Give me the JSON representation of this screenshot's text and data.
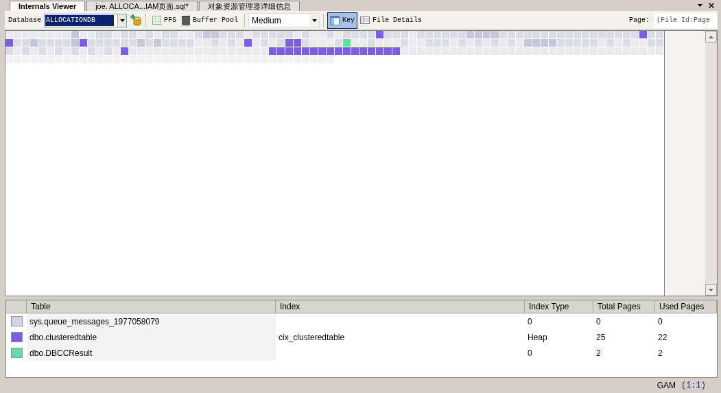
{
  "tabs": [
    {
      "label": "Internals Viewer",
      "selected": true
    },
    {
      "label": "joe. ALLOCA...IAM页面.sql*",
      "selected": false
    },
    {
      "label": "对象资源管理器详细信息",
      "selected": false
    }
  ],
  "toolbar": {
    "database_label": "Database",
    "database": {
      "value": "ALLOCATIONDB",
      "text_selected": true
    },
    "toggles": [
      {
        "kind": "pfs",
        "label": "PFS",
        "selected": false
      },
      {
        "kind": "buffer",
        "label": "Buffer Pool",
        "selected": false
      }
    ],
    "size": {
      "value": "Medium"
    },
    "view_toggles": [
      {
        "kind": "key",
        "label": "Key",
        "selected": true
      },
      {
        "kind": "details",
        "label": "File Details",
        "selected": false
      }
    ],
    "page_label": "Page:",
    "page_field": {
      "placeholder": "(File Id:Page"
    }
  },
  "page_map": {
    "rows": [
      [
        {
          "color": "#ebebef"
        },
        {
          "color": "#ebebef"
        },
        {
          "color": "#ebebef"
        },
        {
          "color": "#ebebef"
        },
        {
          "color": "#ebebef"
        },
        {
          "color": "#ebebef"
        },
        {
          "color": "#ebebef"
        },
        {
          "color": "#ebebef"
        },
        {
          "color": "#c6c6da"
        },
        {
          "color": "#ebebef"
        },
        {
          "color": "#ebebef"
        },
        {
          "color": "#dcdce9"
        },
        {
          "color": "#dcdce9"
        },
        {
          "color": "#ebebef"
        },
        {
          "color": "#dcdce9"
        },
        {
          "color": "#dcdce9"
        },
        {
          "color": "#ebebef"
        },
        {
          "color": "#dcdce9"
        },
        {
          "color": "#ebebef"
        },
        {
          "color": "#dcdce9"
        },
        {
          "color": "#dcdce9"
        },
        {
          "color": "#ebebef"
        },
        {
          "color": "#ebebef"
        },
        {
          "color": "#dcdce9"
        },
        {
          "color": "#c6c6da"
        },
        {
          "color": "#c6c6da"
        },
        {
          "color": "#dcdce9"
        },
        {
          "color": "#dcdce9"
        },
        {
          "color": "#dcdce9"
        },
        {
          "color": "#ebebef"
        },
        {
          "color": "#dcdce9"
        },
        {
          "color": "#dcdce9"
        },
        {
          "color": "#dcdce9"
        },
        {
          "color": "#dcdce9"
        },
        {
          "color": "#dcdce9"
        },
        {
          "color": "#ebebef"
        },
        {
          "color": "#dcdce9"
        },
        {
          "color": "#ebebef"
        },
        {
          "color": "#ebebef"
        },
        {
          "color": "#dcdce9"
        },
        {
          "color": "#ebebef"
        },
        {
          "color": "#dcdce9"
        },
        {
          "color": "#dcdce9"
        },
        {
          "color": "#dcdce9"
        },
        {
          "color": "#dcdce9"
        },
        {
          "color": "#7b5fe0"
        },
        {
          "color": "#dcdce9"
        },
        {
          "color": "#dcdce9"
        },
        {
          "color": "#dcdce9"
        },
        {
          "color": "#ebebef"
        },
        {
          "color": "#dcdce9"
        },
        {
          "color": "#dcdce9"
        },
        {
          "color": "#dcdce9"
        },
        {
          "color": "#dcdce9"
        },
        {
          "color": "#dcdce9"
        },
        {
          "color": "#dcdce9"
        },
        {
          "color": "#c6c6da"
        },
        {
          "color": "#c6c6da"
        },
        {
          "color": "#c6c6da"
        },
        {
          "color": "#c6c6da"
        },
        {
          "color": "#dcdce9"
        },
        {
          "color": "#dcdce9"
        },
        {
          "color": "#dcdce9"
        },
        {
          "color": "#dcdce9"
        },
        {
          "color": "#dcdce9"
        },
        {
          "color": "#dcdce9"
        },
        {
          "color": "#dcdce9"
        },
        {
          "color": "#dcdce9"
        },
        {
          "color": "#dcdce9"
        },
        {
          "color": "#dcdce9"
        },
        {
          "color": "#dcdce9"
        },
        {
          "color": "#dcdce9"
        },
        {
          "color": "#dcdce9"
        },
        {
          "color": "#dcdce9"
        },
        {
          "color": "#dcdce9"
        },
        {
          "color": "#dcdce9"
        },
        {
          "color": "#dcdce9"
        },
        {
          "color": "#7b5fe0"
        },
        {
          "color": "#dcdce9"
        },
        {
          "color": "#dcdce9"
        }
      ],
      [
        {
          "color": "#7b5fe0"
        },
        {
          "color": "#dcdce9"
        },
        {
          "color": "#dcdce9"
        },
        {
          "color": "#c6c6da"
        },
        {
          "color": "#dcdce9"
        },
        {
          "color": "#dcdce9"
        },
        {
          "color": "#dcdce9"
        },
        {
          "color": "#dcdce9"
        },
        {
          "color": "#c6c6da"
        },
        {
          "color": "#7b5fe0"
        },
        {
          "color": "#dcdce9"
        },
        {
          "color": "#dcdce9"
        },
        {
          "color": "#dcdce9"
        },
        {
          "color": "#dcdce9"
        },
        {
          "color": "#dcdce9"
        },
        {
          "color": "#dcdce9"
        },
        {
          "color": "#c6c6da"
        },
        {
          "color": "#dcdce9"
        },
        {
          "color": "#c6c6da"
        },
        {
          "color": "#dcdce9"
        },
        {
          "color": "#dcdce9"
        },
        {
          "color": "#dcdce9"
        },
        {
          "color": "#dcdce9"
        },
        {
          "color": "#ebebef"
        },
        {
          "color": "#ebebef"
        },
        {
          "color": "#dcdce9"
        },
        {
          "color": "#ebebef"
        },
        {
          "color": "#dcdce9"
        },
        {
          "color": "#ebebef"
        },
        {
          "color": "#7b5fe0"
        },
        {
          "color": "#ebebef"
        },
        {
          "color": "#dcdce9"
        },
        {
          "color": "#ebebef"
        },
        {
          "color": "#dcdce9"
        },
        {
          "color": "#7b5fe0"
        },
        {
          "color": "#7b5fe0"
        },
        {
          "color": "#dcdce9"
        },
        {
          "color": "#ebebef"
        },
        {
          "color": "#ebebef"
        },
        {
          "color": "#ebebef"
        },
        {
          "color": "#dcdce9"
        },
        {
          "color": "#5fe0a0"
        },
        {
          "color": "#ebebef"
        },
        {
          "color": "#ebebef"
        },
        {
          "color": "#dcdce9"
        },
        {
          "color": "#ebebef"
        },
        {
          "color": "#ebebef"
        },
        {
          "color": "#ebebef"
        },
        {
          "color": "#dcdce9"
        },
        {
          "color": "#ebebef"
        },
        {
          "color": "#ebebef"
        },
        {
          "color": "#dcdce9"
        },
        {
          "color": "#dcdce9"
        },
        {
          "color": "#dcdce9"
        },
        {
          "color": "#ebebef"
        },
        {
          "color": "#dcdce9"
        },
        {
          "color": "#ebebef"
        },
        {
          "color": "#dcdce9"
        },
        {
          "color": "#ebebef"
        },
        {
          "color": "#dcdce9"
        },
        {
          "color": "#ebebef"
        },
        {
          "color": "#dcdce9"
        },
        {
          "color": "#ebebef"
        },
        {
          "color": "#c6c6da"
        },
        {
          "color": "#c6c6da"
        },
        {
          "color": "#c6c6da"
        },
        {
          "color": "#c6c6da"
        },
        {
          "color": "#dcdce9"
        },
        {
          "color": "#dcdce9"
        },
        {
          "color": "#dcdce9"
        },
        {
          "color": "#dcdce9"
        },
        {
          "color": "#dcdce9"
        },
        {
          "color": "#ebebef"
        },
        {
          "color": "#dcdce9"
        },
        {
          "color": "#ebebef"
        },
        {
          "color": "#dcdce9"
        },
        {
          "color": "#ebebef"
        },
        {
          "color": "#ebebef"
        },
        {
          "color": "#dcdce9"
        },
        {
          "color": "#dcdce9"
        }
      ],
      [
        {
          "color": "#dcdce9"
        },
        {
          "color": "#ebebef"
        },
        {
          "color": "#dcdce9"
        },
        {
          "color": "#ebebef"
        },
        {
          "color": "#dcdce9"
        },
        {
          "color": "#ebebef"
        },
        {
          "color": "#dcdce9"
        },
        {
          "color": "#ebebef"
        },
        {
          "color": "#dcdce9"
        },
        {
          "color": "#ebebef"
        },
        {
          "color": "#dcdce9"
        },
        {
          "color": "#ebebef"
        },
        {
          "color": "#dcdce9"
        },
        {
          "color": "#ebebef"
        },
        {
          "color": "#7b5fe0"
        },
        {
          "color": "#ebebef"
        },
        {
          "color": "#ebebef"
        },
        {
          "color": "#ebebef"
        },
        {
          "color": "#ebebef"
        },
        {
          "color": "#ebebef"
        },
        {
          "color": "#ebebef"
        },
        {
          "color": "#ebebef"
        },
        {
          "color": "#ebebef"
        },
        {
          "color": "#ebebef"
        },
        {
          "color": "#ebebef"
        },
        {
          "color": "#ebebef"
        },
        {
          "color": "#ebebef"
        },
        {
          "color": "#ebebef"
        },
        {
          "color": "#ebebef"
        },
        {
          "color": "#ebebef"
        },
        {
          "color": "#ebebef"
        },
        {
          "color": "#ebebef"
        },
        {
          "color": "#7b5fe0"
        },
        {
          "color": "#7b5fe0"
        },
        {
          "color": "#7b5fe0"
        },
        {
          "color": "#7b5fe0"
        },
        {
          "color": "#7b5fe0"
        },
        {
          "color": "#7b5fe0"
        },
        {
          "color": "#7b5fe0"
        },
        {
          "color": "#7b5fe0"
        },
        {
          "color": "#7b5fe0"
        },
        {
          "color": "#7b5fe0"
        },
        {
          "color": "#7b5fe0"
        },
        {
          "color": "#7b5fe0"
        },
        {
          "color": "#7b5fe0"
        },
        {
          "color": "#7b5fe0"
        },
        {
          "color": "#7b5fe0"
        },
        {
          "color": "#7b5fe0"
        },
        {
          "color": "#ebebef"
        },
        {
          "color": "#ebebef"
        },
        {
          "color": "#ebebef"
        },
        {
          "color": "#ebebef"
        },
        {
          "color": "#ebebef"
        },
        {
          "color": "#ebebef"
        },
        {
          "color": "#ebebef"
        },
        {
          "color": "#ebebef"
        },
        {
          "color": "#ebebef"
        },
        {
          "color": "#ebebef"
        },
        {
          "color": "#ebebef"
        },
        {
          "color": "#ebebef"
        },
        {
          "color": "#ebebef"
        },
        {
          "color": "#ebebef"
        },
        {
          "color": "#ebebef"
        },
        {
          "color": "#ebebef"
        },
        {
          "color": "#ebebef"
        },
        {
          "color": "#ebebef"
        },
        {
          "color": "#ebebef"
        },
        {
          "color": "#ebebef"
        },
        {
          "color": "#ebebef"
        },
        {
          "color": "#ebebef"
        },
        {
          "color": "#ebebef"
        },
        {
          "color": "#ebebef"
        },
        {
          "color": "#ebebef"
        },
        {
          "color": "#ebebef"
        },
        {
          "color": "#ebebef"
        },
        {
          "color": "#ebebef"
        },
        {
          "color": "#ebebef"
        },
        {
          "color": "#ebebef"
        },
        {
          "color": "#ebebef"
        },
        {
          "color": "#ebebef"
        }
      ],
      [
        {
          "color": "#f3f3f3"
        },
        {
          "color": "#f3f3f3"
        },
        {
          "color": "#f3f3f3"
        },
        {
          "color": "#f3f3f3"
        },
        {
          "color": "#f3f3f3"
        },
        {
          "color": "#f3f3f3"
        },
        {
          "color": "#f3f3f3"
        },
        {
          "color": "#f3f3f3"
        },
        {
          "color": "#f3f3f3"
        },
        {
          "color": "#f3f3f3"
        },
        {
          "color": "#f3f3f3"
        },
        {
          "color": "#f3f3f3"
        },
        {
          "color": "#f3f3f3"
        },
        {
          "color": "#f3f3f3"
        },
        {
          "color": "#f3f3f3"
        },
        {
          "color": "#f3f3f3"
        },
        {
          "color": "#f3f3f3"
        },
        {
          "color": "#f3f3f3"
        },
        {
          "color": "#f3f3f3"
        },
        {
          "color": "#f3f3f3"
        },
        {
          "color": "#f3f3f3"
        },
        {
          "color": "#f3f3f3"
        },
        {
          "color": "#f3f3f3"
        },
        {
          "color": "#f3f3f3"
        },
        {
          "color": "#f3f3f3"
        },
        {
          "color": "#f3f3f3"
        },
        {
          "color": "#f3f3f3"
        },
        {
          "color": "#f3f3f3"
        },
        {
          "color": "#f3f3f3"
        },
        {
          "color": "#f3f3f3"
        },
        {
          "color": "#f3f3f3"
        },
        {
          "color": "#f3f3f3"
        },
        {
          "color": "#f3f3f3"
        },
        {
          "color": "#f3f3f3"
        },
        {
          "color": "#f3f3f3"
        },
        {
          "color": "#f3f3f3"
        },
        {
          "color": "#f3f3f3"
        },
        {
          "color": "#f3f3f3"
        },
        {
          "color": "#f3f3f3"
        },
        {
          "color": "#f3f3f3"
        }
      ]
    ]
  },
  "legend": {
    "columns": [
      "Table",
      "Index",
      "Index Type",
      "Total Pages",
      "Used Pages"
    ],
    "rows": [
      {
        "color": "#d3d3e3",
        "table": "sys.queue_messages_1977058079",
        "index_type": "0",
        "total_pages": "0",
        "used_pages": "0"
      },
      {
        "color": "#7b5fe0",
        "table": "dbo.clusteredtable",
        "index": "cix_clusteredtable",
        "index_type": "Heap",
        "total_pages": "25",
        "used_pages": "22"
      },
      {
        "color": "#5fe0a0",
        "table": "dbo.DBCCResult",
        "index_type": "0",
        "total_pages": "2",
        "used_pages": "2"
      }
    ]
  },
  "status_bar": {
    "map_type": "GAM",
    "page": "(1:1)"
  }
}
